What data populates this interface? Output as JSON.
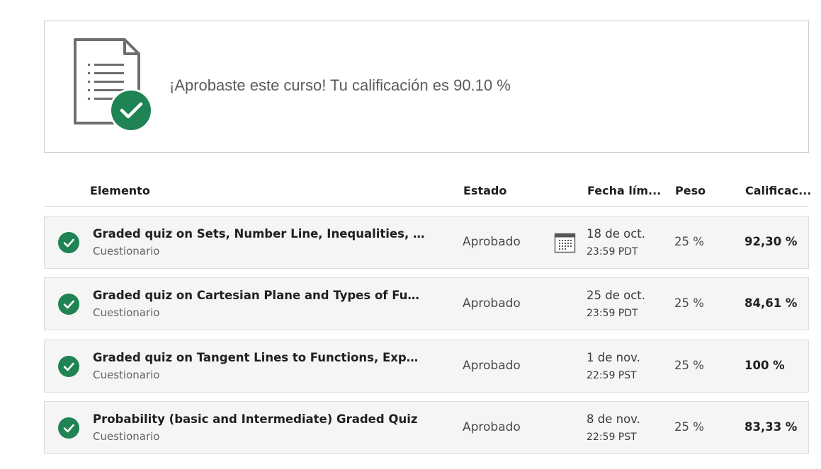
{
  "banner": {
    "message": "¡Aprobaste este curso! Tu calificación es 90.10 %",
    "icon": "document-check-icon",
    "accent_color": "#1f8354"
  },
  "table": {
    "headers": {
      "item": "Elemento",
      "status": "Estado",
      "due": "Fecha lím...",
      "weight": "Peso",
      "grade": "Calificac..."
    },
    "rows": [
      {
        "title": "Graded quiz on Sets, Number Line, Inequalities, Si...",
        "type": "Cuestionario",
        "status": "Aprobado",
        "date": "18 de oct.",
        "time": "23:59 PDT",
        "weight": "25 %",
        "grade": "92,30 %",
        "show_calendar": true
      },
      {
        "title": "Graded quiz on Cartesian Plane and Types of Funct...",
        "type": "Cuestionario",
        "status": "Aprobado",
        "date": "25 de oct.",
        "time": "23:59 PDT",
        "weight": "25 %",
        "grade": "84,61 %",
        "show_calendar": false
      },
      {
        "title": "Graded quiz on Tangent Lines to Functions, Expone...",
        "type": "Cuestionario",
        "status": "Aprobado",
        "date": "1 de nov.",
        "time": "22:59 PST",
        "weight": "25 %",
        "grade": "100 %",
        "show_calendar": false
      },
      {
        "title": "Probability (basic and Intermediate) Graded Quiz",
        "type": "Cuestionario",
        "status": "Aprobado",
        "date": "8 de nov.",
        "time": "22:59 PST",
        "weight": "25 %",
        "grade": "83,33 %",
        "show_calendar": false
      }
    ]
  }
}
